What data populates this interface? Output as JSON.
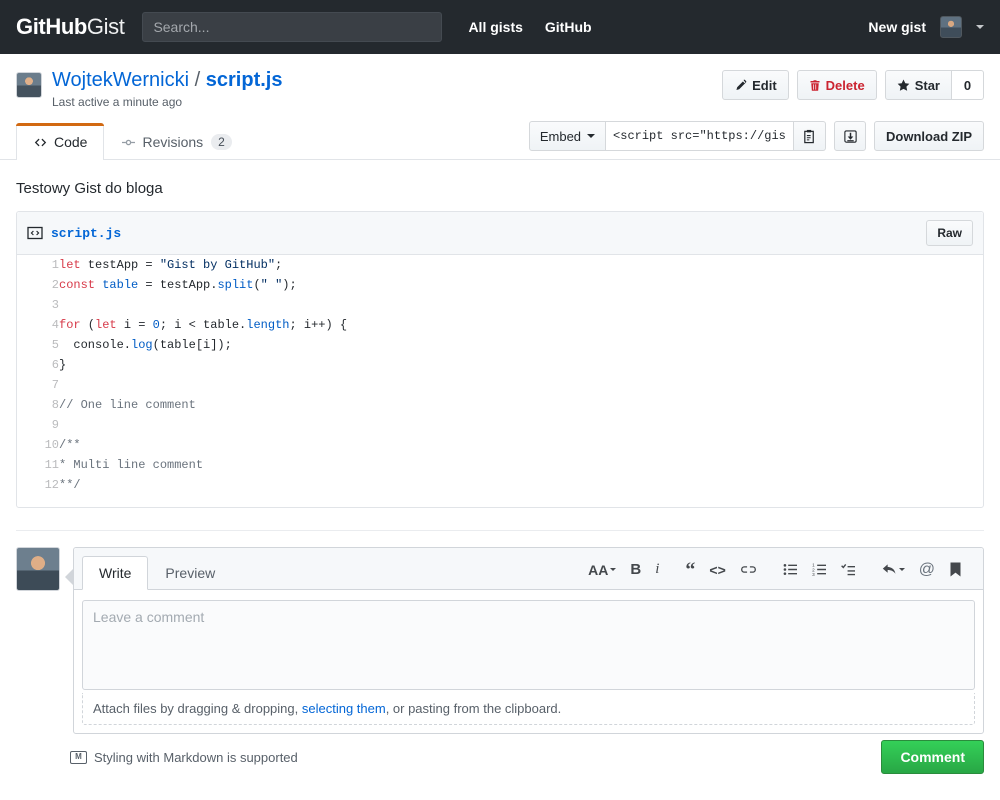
{
  "topnav": {
    "logo_bold": "GitHub",
    "logo_rest": "Gist",
    "search_placeholder": "Search...",
    "links": [
      {
        "label": "All gists"
      },
      {
        "label": "GitHub"
      }
    ],
    "new_gist_label": "New gist"
  },
  "gist": {
    "owner": "WojtekWernicki",
    "separator": "/",
    "filename": "script.js",
    "last_active": "Last active a minute ago",
    "description": "Testowy Gist do bloga",
    "actions": {
      "edit_label": "Edit",
      "delete_label": "Delete",
      "star_label": "Star",
      "star_count": "0"
    }
  },
  "tabs": [
    {
      "label": "Code",
      "badge": "",
      "active": true
    },
    {
      "label": "Revisions",
      "badge": "2",
      "active": false
    }
  ],
  "embed": {
    "select_label": "Embed",
    "url_value": "<script src=\"https://gist.",
    "download_zip_label": "Download ZIP"
  },
  "file": {
    "name": "script.js",
    "raw_label": "Raw",
    "lines": [
      {
        "n": "1",
        "tokens": [
          {
            "t": "let",
            "c": "k"
          },
          {
            "t": " testApp = ",
            "c": ""
          },
          {
            "t": "\"Gist by GitHub\"",
            "c": "s"
          },
          {
            "t": ";",
            "c": ""
          }
        ]
      },
      {
        "n": "2",
        "tokens": [
          {
            "t": "const",
            "c": "k"
          },
          {
            "t": " ",
            "c": ""
          },
          {
            "t": "table",
            "c": "f"
          },
          {
            "t": " = testApp.",
            "c": ""
          },
          {
            "t": "split",
            "c": "f"
          },
          {
            "t": "(",
            "c": ""
          },
          {
            "t": "\" \"",
            "c": "s"
          },
          {
            "t": ");",
            "c": ""
          }
        ]
      },
      {
        "n": "3",
        "tokens": [
          {
            "t": "",
            "c": ""
          }
        ]
      },
      {
        "n": "4",
        "tokens": [
          {
            "t": "for",
            "c": "k"
          },
          {
            "t": " (",
            "c": ""
          },
          {
            "t": "let",
            "c": "k"
          },
          {
            "t": " i = ",
            "c": ""
          },
          {
            "t": "0",
            "c": "f"
          },
          {
            "t": "; i < table.",
            "c": ""
          },
          {
            "t": "length",
            "c": "f"
          },
          {
            "t": "; i++) {",
            "c": ""
          }
        ]
      },
      {
        "n": "5",
        "tokens": [
          {
            "t": "  console.",
            "c": ""
          },
          {
            "t": "log",
            "c": "f"
          },
          {
            "t": "(table[i]);",
            "c": ""
          }
        ]
      },
      {
        "n": "6",
        "tokens": [
          {
            "t": "}",
            "c": ""
          }
        ]
      },
      {
        "n": "7",
        "tokens": [
          {
            "t": "",
            "c": ""
          }
        ]
      },
      {
        "n": "8",
        "tokens": [
          {
            "t": "// One line comment",
            "c": "c"
          }
        ]
      },
      {
        "n": "9",
        "tokens": [
          {
            "t": "",
            "c": ""
          }
        ]
      },
      {
        "n": "10",
        "tokens": [
          {
            "t": "/**",
            "c": "c"
          }
        ]
      },
      {
        "n": "11",
        "tokens": [
          {
            "t": "* Multi line comment",
            "c": "c"
          }
        ]
      },
      {
        "n": "12",
        "tokens": [
          {
            "t": "**/",
            "c": "c"
          }
        ]
      }
    ]
  },
  "comment_form": {
    "tabs": [
      {
        "label": "Write",
        "active": true
      },
      {
        "label": "Preview",
        "active": false
      }
    ],
    "toolbar": [
      {
        "name": "text-size-icon",
        "glyph": "AA"
      },
      {
        "name": "bold-icon",
        "glyph": "B"
      },
      {
        "name": "italic-icon",
        "glyph": "i"
      },
      {
        "name": "quote-icon",
        "glyph": "“"
      },
      {
        "name": "code-icon",
        "glyph": "<>"
      },
      {
        "name": "link-icon",
        "glyph": "∞"
      },
      {
        "name": "bulleted-list-icon",
        "glyph": "☰"
      },
      {
        "name": "numbered-list-icon",
        "glyph": "☰"
      },
      {
        "name": "task-list-icon",
        "glyph": "✓"
      },
      {
        "name": "reply-icon",
        "glyph": "↰"
      },
      {
        "name": "mention-icon",
        "glyph": "@"
      },
      {
        "name": "saved-replies-icon",
        "glyph": "⚑"
      }
    ],
    "placeholder": "Leave a comment",
    "attach_prefix": "Attach files by dragging & dropping, ",
    "attach_link": "selecting them",
    "attach_suffix": ", or pasting from the clipboard.",
    "markdown_hint": "Styling with Markdown is supported",
    "markdown_icon_text": "M",
    "submit_label": "Comment"
  },
  "colors": {
    "nav_bg": "#24292e",
    "accent_blue": "#0366d6",
    "danger_red": "#cb2431",
    "tab_active_orange": "#d26911",
    "comment_green": "#28a745",
    "keyword": "#d73a49",
    "string": "#032f62",
    "comment_token": "#6a737d",
    "function_token": "#005cc5"
  }
}
